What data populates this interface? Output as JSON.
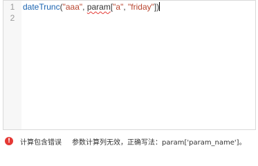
{
  "editor": {
    "line_numbers": [
      "1",
      "2"
    ],
    "code": {
      "fn_name": "dateTrunc",
      "open_paren": "(",
      "arg1": "\"aaa\"",
      "comma1": ", ",
      "param_word": "param",
      "bracket_open": "[",
      "arg2": "\"a\"",
      "comma2": ", ",
      "arg3": "\"friday\"",
      "bracket_close": "]",
      "close_paren": ")"
    }
  },
  "status": {
    "icon": "exclamation-icon",
    "error_title": "计算包含错误",
    "error_message": "参数计算列无效，正确写法：param['param_name']。"
  },
  "colors": {
    "function": "#1a63b0",
    "string": "#b8442d",
    "error": "#e53935"
  }
}
